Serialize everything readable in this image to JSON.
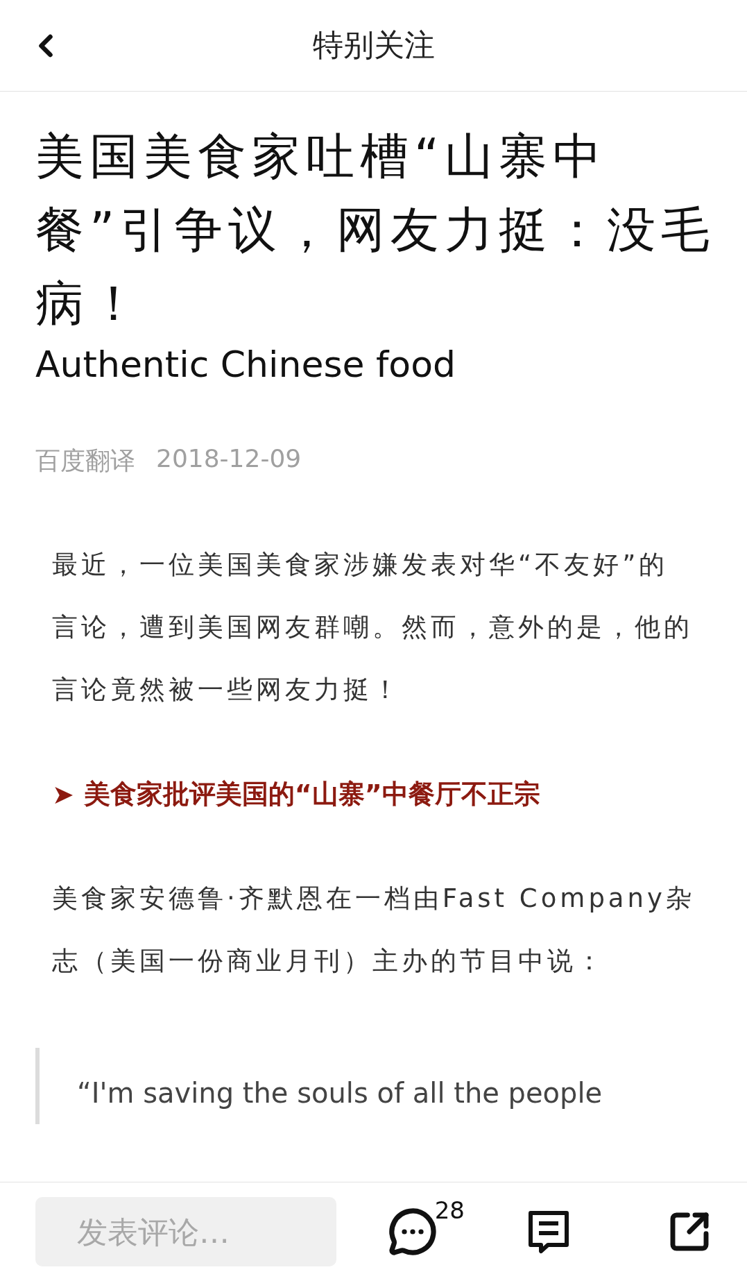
{
  "header": {
    "title": "特别关注"
  },
  "article": {
    "title": "美国美食家吐槽“山寨中餐”引争议，网友力挺：没毛病！",
    "subtitle": "Authentic Chinese food",
    "source": "百度翻译",
    "date": "2018-12-09",
    "blocks": [
      {
        "kind": "paragraph",
        "text": "最近，一位美国美食家涉嫌发表对华“不友好”的言论，遭到美国网友群嘲。然而，意外的是，他的言论竟然被一些网友力挺！"
      },
      {
        "kind": "heading",
        "marker": "➤",
        "text": "美食家批评美国的“山寨”中餐厅不正宗"
      },
      {
        "kind": "paragraph",
        "text": "美食家安德鲁·齐默恩在一档由Fast Company杂志（美国一份商业月刊）主办的节目中说："
      },
      {
        "kind": "quote",
        "text": "“I'm saving the souls of all the people"
      }
    ]
  },
  "bottom_bar": {
    "comment_placeholder": "发表评论…",
    "comment_count": "28"
  }
}
